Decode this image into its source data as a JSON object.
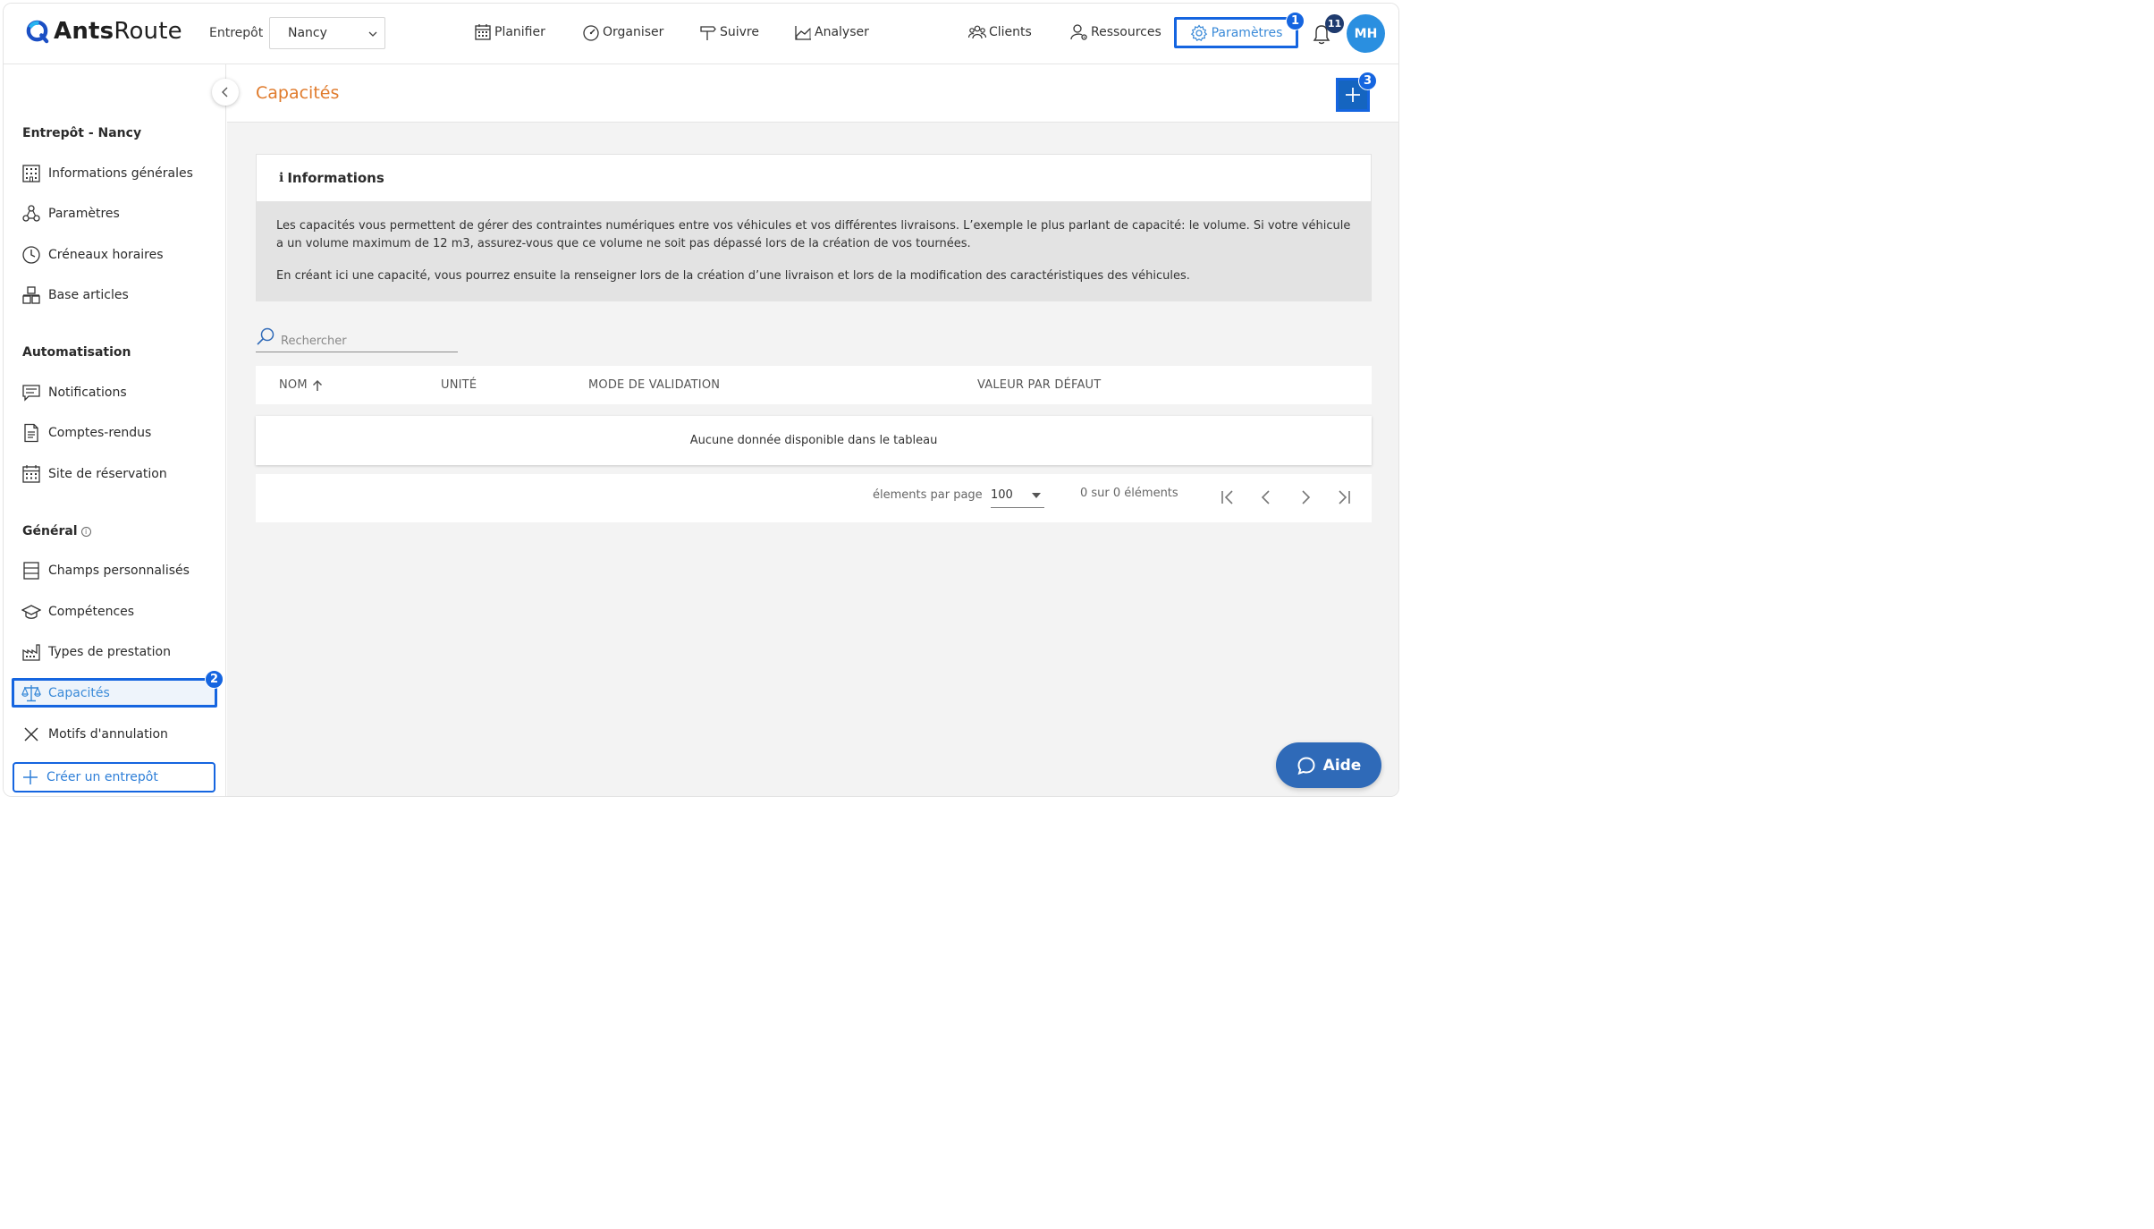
{
  "brand": {
    "name_bold": "Ants",
    "name_regular": "Route",
    "logo_icon": "ants-logo-icon",
    "accent": "#1565e0"
  },
  "header": {
    "warehouse_label": "Entrepôt",
    "warehouse_value": "Nancy",
    "nav": [
      {
        "label": "Planifier",
        "icon": "calendar-icon"
      },
      {
        "label": "Organiser",
        "icon": "gauge-icon"
      },
      {
        "label": "Suivre",
        "icon": "signpost-icon"
      },
      {
        "label": "Analyser",
        "icon": "chart-icon"
      },
      {
        "label": "Clients",
        "icon": "users-icon"
      },
      {
        "label": "Ressources",
        "icon": "user-gear-icon"
      },
      {
        "label": "Paramètres",
        "icon": "gear-icon"
      }
    ],
    "notifications_count": "11",
    "avatar_initials": "MH",
    "step_badges": {
      "params": "1",
      "sidebar": "2",
      "add": "3"
    }
  },
  "sidebar": {
    "section_warehouse": "Entrepôt - Nancy",
    "section_automation": "Automatisation",
    "section_general": "Général",
    "warehouse_items": [
      {
        "label": "Informations générales",
        "icon": "building-icon"
      },
      {
        "label": "Paramètres",
        "icon": "settings-nodes-icon"
      },
      {
        "label": "Créneaux horaires",
        "icon": "clock-icon"
      },
      {
        "label": "Base articles",
        "icon": "boxes-icon"
      }
    ],
    "automation_items": [
      {
        "label": "Notifications",
        "icon": "message-icon"
      },
      {
        "label": "Comptes-rendus",
        "icon": "document-icon"
      },
      {
        "label": "Site de réservation",
        "icon": "calendar-grid-icon"
      }
    ],
    "general_items": [
      {
        "label": "Champs personnalisés",
        "icon": "list-fields-icon"
      },
      {
        "label": "Compétences",
        "icon": "graduation-cap-icon"
      },
      {
        "label": "Types de prestation",
        "icon": "factory-icon"
      },
      {
        "label": "Capacités",
        "icon": "scale-icon",
        "active": true
      },
      {
        "label": "Motifs d'annulation",
        "icon": "x-icon"
      }
    ],
    "create_button": "Créer un entrepôt"
  },
  "main": {
    "title": "Capacités",
    "info_title": "Informations",
    "info_glyph": "ℹ",
    "info_paragraph_1": "Les capacités vous permettent de gérer des contraintes numériques entre vos véhicules et vos différentes livraisons. L’exemple le plus parlant de capacité: le volume. Si votre véhicule a un volume maximum de 12 m3, assurez-vous que ce volume ne soit pas dépassé lors de la création de vos tournées.",
    "info_paragraph_2": "En créant ici une capacité, vous pourrez ensuite la renseigner lors de la création d’une livraison et lors de la modification des caractéristiques des véhicules.",
    "search_placeholder": "Rechercher",
    "columns": [
      "NOM",
      "UNITÉ",
      "MODE DE VALIDATION",
      "VALEUR PAR DÉFAUT"
    ],
    "empty_message": "Aucune donnée disponible dans le tableau",
    "paginator": {
      "items_per_page_label": "élements par page",
      "items_per_page": "100",
      "range_label": "0 sur 0 éléments"
    }
  },
  "help_button": "Aide"
}
